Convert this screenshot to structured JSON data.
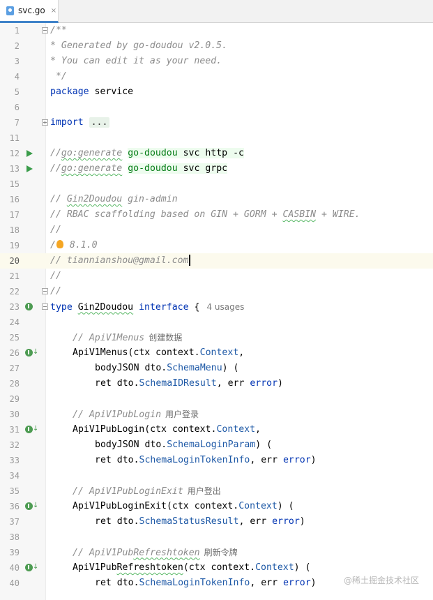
{
  "tab": {
    "label": "svc.go",
    "close": "×"
  },
  "code": {
    "l1": "/**",
    "l2": "* Generated by go-doudou v2.0.5.",
    "l3": "* You can edit it as your need.",
    "l4": " */",
    "l5_kw": "package",
    "l5_name": "service",
    "l7_kw": "import",
    "l7_fold": "...",
    "gen_prefix": "//",
    "gen_directive": "go:generate",
    "gen_tool": "go-doudou",
    "l12_args": "svc http -c",
    "l13_args": "svc grpc",
    "l15_pre": "// ",
    "l15_name": "Gin2Doudou",
    "l15_post": " gin-admin",
    "l16_pre": "// RBAC scaffolding based on GIN + GORM + ",
    "l16_casbin": "CASBIN",
    "l16_post": " + WIRE.",
    "l17": "//",
    "l18_pre": "/",
    "l18_post": " 8.1.0",
    "l19": "// tiannianshou@gmail.com",
    "l20": "//",
    "l21": "//",
    "l22_kw": "type",
    "l22_name": "Gin2Doudou",
    "l22_kw2": "interface",
    "l22_brace": " {",
    "l22_usages": "4 usages",
    "l24_comment": "// ApiV1Menus",
    "l24_cn": "创建数据",
    "l25_fn": "ApiV1Menus(",
    "l25_param": "ctx ",
    "l25_pkg": "context.",
    "l25_type": "Context",
    "l25_end": ",",
    "l26_param": "bodyJSON ",
    "l26_pkg": "dto.",
    "l26_type": "SchemaMenu",
    "l26_end": ") (",
    "l27_param": "ret ",
    "l27_pkg": "dto.",
    "l27_type": "SchemaIDResult",
    "l27_mid": ", err ",
    "l27_err": "error",
    "l27_end": ")",
    "l29_comment": "// ApiV1PubLogin",
    "l29_cn": "用户登录",
    "l30_fn": "ApiV1PubLogin(",
    "l32_type": "SchemaLoginTokenInfo",
    "l31_type": "SchemaLoginParam",
    "l34_comment": "// ApiV1PubLoginExit",
    "l34_cn": "用户登出",
    "l35_fn": "ApiV1PubLoginExit(",
    "l35_end": ") (",
    "l36_type": "SchemaStatusResult",
    "l38_pre": "// ApiV1Pub",
    "l38_sq": "Refreshtoken",
    "l38_cn": "刷新令牌",
    "l39_pre": "ApiV1Pub",
    "l39_sq": "Refreshtoken",
    "l39_open": "(",
    "l40_type": "SchemaLoginTokenInfo"
  },
  "line_numbers": [
    "1",
    "2",
    "3",
    "4",
    "5",
    "6",
    "7",
    "11",
    "12",
    "13",
    "15",
    "16",
    "17",
    "18",
    "19",
    "20",
    "21",
    "22",
    "23",
    "24",
    "25",
    "26",
    "27",
    "28",
    "29",
    "30",
    "31",
    "32",
    "33",
    "34",
    "35",
    "36",
    "37",
    "38",
    "39",
    "40"
  ],
  "watermark": "@稀土掘金技术社区",
  "colors": {
    "keyword": "#0033b3",
    "type": "#1d58a6",
    "comment": "#8c8c8c",
    "tool": "#067d17",
    "run": "#3a9c4a"
  }
}
